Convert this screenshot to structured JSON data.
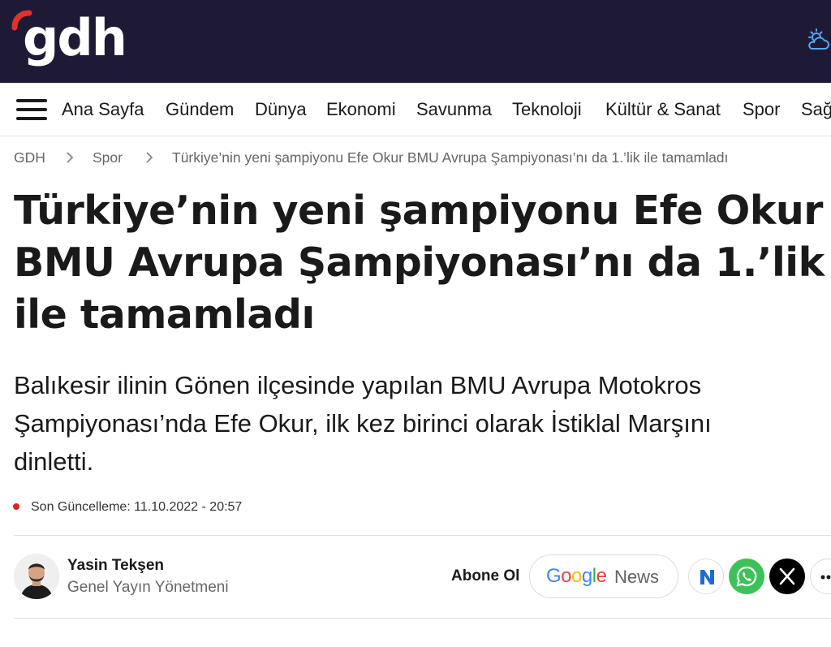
{
  "header": {
    "logo_text": "gdh",
    "weather_icon": "weather-cloud-sun-icon",
    "colors": {
      "background": "#1e1a36",
      "logo_accent": "#e0312b"
    }
  },
  "nav": {
    "menu_icon": "hamburger-menu-icon",
    "items": [
      "Ana Sayfa",
      "Gündem",
      "Dünya",
      "Ekonomi",
      "Savunma",
      "Teknoloji",
      "Kültür & Sanat",
      "Spor",
      "Sağ"
    ]
  },
  "breadcrumb": {
    "items": [
      "GDH",
      "Spor",
      "Türkiye’nin yeni şampiyonu Efe Okur BMU Avrupa Şampiyonası’nı da 1.’lik ile tamamladı"
    ],
    "separator_icon": "chevron-right-icon"
  },
  "article": {
    "headline_lines": [
      "Türkiye’nin yeni şampiyonu Efe Okur",
      "BMU Avrupa Şampiyonası’nı da 1.’lik",
      "ile tamamladı"
    ],
    "summary_lines": [
      "Balıkesir ilinin Gönen ilçesinde yapılan BMU Avrupa Motokros",
      "Şampiyonası’nda Efe Okur, ilk kez birinci olarak İstiklal Marşını",
      "dinletti."
    ],
    "updated": "Son Güncelleme: 11.10.2022 - 20:57",
    "updated_dot_color": "#d7261c"
  },
  "author": {
    "name": "Yasin Tekşen",
    "role": "Genel Yayın Yönetmeni",
    "avatar_icon": "author-avatar"
  },
  "share": {
    "subscribe_label": "Abone Ol",
    "google_news": {
      "google": "Google",
      "news": "News"
    },
    "buttons": [
      {
        "icon": "newsstand-n-icon",
        "color": "#ffffff"
      },
      {
        "icon": "whatsapp-icon",
        "color": "#3dc25a"
      },
      {
        "icon": "x-twitter-icon",
        "color": "#000000"
      },
      {
        "icon": "more-dots-icon",
        "color": "#ffffff"
      }
    ]
  }
}
